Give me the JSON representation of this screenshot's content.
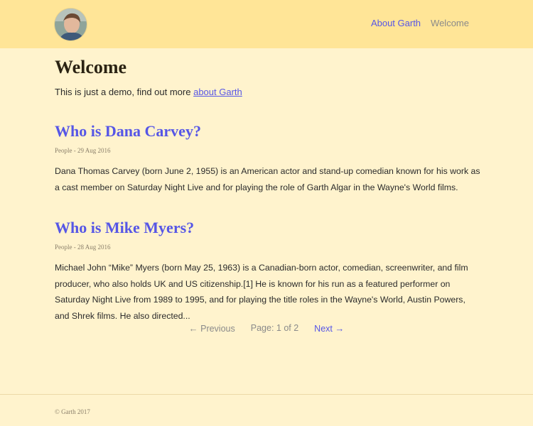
{
  "header": {
    "avatar_name": "avatar-photo",
    "nav": [
      {
        "label": "About Garth"
      },
      {
        "label": "Welcome"
      }
    ]
  },
  "main": {
    "title": "Welcome",
    "intro_text": "This is just a demo, find out more ",
    "intro_link": "about Garth",
    "posts": [
      {
        "title": "Who is Dana Carvey?",
        "meta": "People - 29 Aug 2016",
        "excerpt": "Dana Thomas Carvey (born June 2, 1955) is an American actor and stand-up comedian known for his work as a cast member on Saturday Night Live and for playing the role of Garth Algar in the Wayne's World films."
      },
      {
        "title": "Who is Mike Myers?",
        "meta": "People - 28 Aug 2016",
        "excerpt": "Michael John “Mike” Myers (born May 25, 1963) is a Canadian-born actor, comedian, screenwriter, and film producer, who also holds UK and US citizenship.[1] He is known for his run as a featured performer on Saturday Night Live from 1989 to 1995, and for playing the title roles in the Wayne's World, Austin Powers, and Shrek films. He also directed..."
      }
    ]
  },
  "pagination": {
    "prev_arrow": "←",
    "prev_label": "Previous",
    "page_info": "Page: 1 of 2",
    "next_label": "Next",
    "next_arrow": "→"
  },
  "footer": {
    "copyright": "© Garth 2017"
  },
  "colors": {
    "header_bg": "#ffe597",
    "page_bg": "#fff3cd",
    "link": "#5656e6",
    "muted": "#8a8a8a"
  }
}
